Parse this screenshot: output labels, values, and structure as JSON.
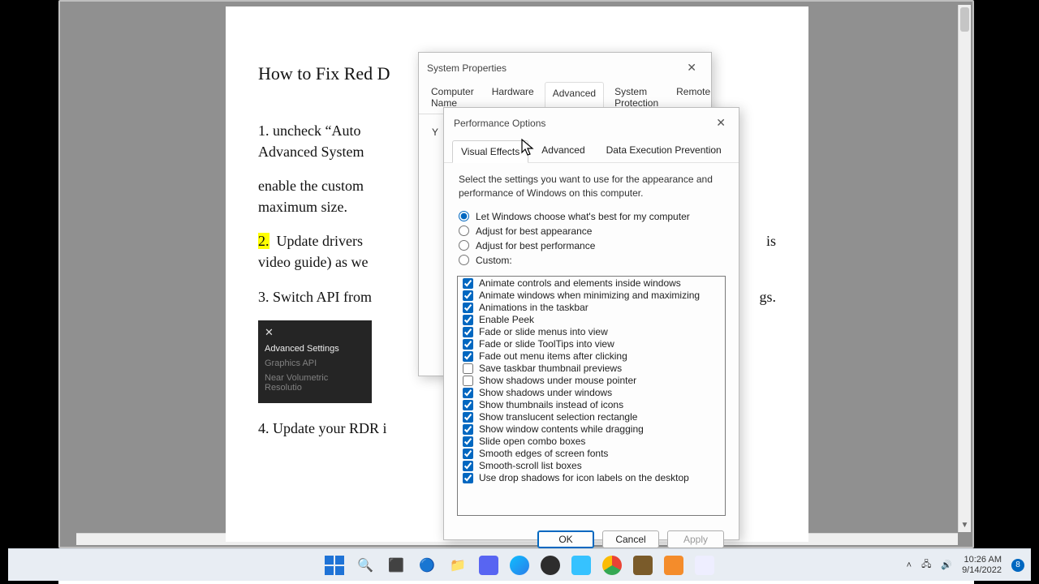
{
  "document": {
    "title": "How to Fix Red D",
    "p1": "1. uncheck “Auto",
    "p1b": "Advanced System",
    "p2": "enable the custom",
    "p2b": "maximum size.",
    "num2": "2.",
    "p3": " Update drivers",
    "p3b": "video guide) as we",
    "p3tail": "is",
    "p4": "3. Switch API from",
    "p4tail": "gs.",
    "p5": "4. Update your RDR i",
    "dark_panel": {
      "close": "✕",
      "title": "Advanced Settings",
      "row1": "Graphics API",
      "row2": "Near Volumetric Resolutio"
    }
  },
  "sysprops": {
    "title": "System Properties",
    "tabs": [
      "Computer Name",
      "Hardware",
      "Advanced",
      "System Protection",
      "Remote"
    ],
    "active_tab": 2,
    "body_line": "Y"
  },
  "perfopts": {
    "title": "Performance Options",
    "tabs": [
      "Visual Effects",
      "Advanced",
      "Data Execution Prevention"
    ],
    "active_tab": 0,
    "description": "Select the settings you want to use for the appearance and performance of Windows on this computer.",
    "radios": [
      {
        "label": "Let Windows choose what's best for my computer",
        "selected": true
      },
      {
        "label": "Adjust for best appearance",
        "selected": false
      },
      {
        "label": "Adjust for best performance",
        "selected": false
      },
      {
        "label": "Custom:",
        "selected": false
      }
    ],
    "checks": [
      {
        "label": "Animate controls and elements inside windows",
        "checked": true
      },
      {
        "label": "Animate windows when minimizing and maximizing",
        "checked": true
      },
      {
        "label": "Animations in the taskbar",
        "checked": true
      },
      {
        "label": "Enable Peek",
        "checked": true
      },
      {
        "label": "Fade or slide menus into view",
        "checked": true
      },
      {
        "label": "Fade or slide ToolTips into view",
        "checked": true
      },
      {
        "label": "Fade out menu items after clicking",
        "checked": true
      },
      {
        "label": "Save taskbar thumbnail previews",
        "checked": false
      },
      {
        "label": "Show shadows under mouse pointer",
        "checked": false
      },
      {
        "label": "Show shadows under windows",
        "checked": true
      },
      {
        "label": "Show thumbnails instead of icons",
        "checked": true
      },
      {
        "label": "Show translucent selection rectangle",
        "checked": true
      },
      {
        "label": "Show window contents while dragging",
        "checked": true
      },
      {
        "label": "Slide open combo boxes",
        "checked": true
      },
      {
        "label": "Smooth edges of screen fonts",
        "checked": true
      },
      {
        "label": "Smooth-scroll list boxes",
        "checked": true
      },
      {
        "label": "Use drop shadows for icon labels on the desktop",
        "checked": true
      }
    ],
    "buttons": {
      "ok": "OK",
      "cancel": "Cancel",
      "apply": "Apply"
    }
  },
  "url": "https://www.youtube.com/user/HowtoFixDllExeErrors/videos",
  "tray": {
    "time": "10:26 AM",
    "date": "9/14/2022",
    "badge": "8"
  },
  "taskbar_icons": [
    "start",
    "search",
    "taskview",
    "widgets",
    "explorer",
    "discord",
    "edge",
    "obs",
    "norton",
    "chrome",
    "minecraft",
    "app1",
    "paint"
  ]
}
